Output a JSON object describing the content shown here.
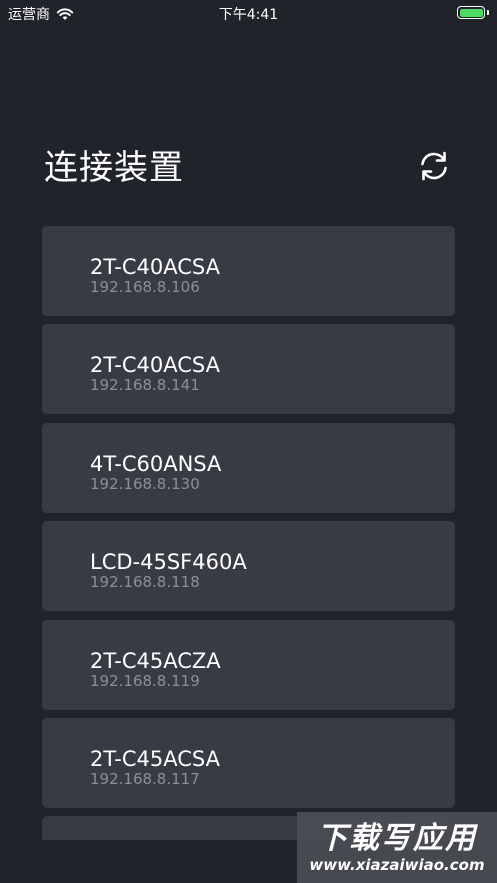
{
  "status_bar": {
    "carrier": "运营商",
    "wifi_icon": "wifi-icon",
    "time": "下午4:41",
    "battery_level": 1.0,
    "battery_color": "#4cd964"
  },
  "header": {
    "title": "连接装置",
    "refresh_icon": "refresh-icon"
  },
  "devices": [
    {
      "name": "2T-C40ACSA",
      "ip": "192.168.8.106"
    },
    {
      "name": "2T-C40ACSA",
      "ip": "192.168.8.141"
    },
    {
      "name": "4T-C60ANSA",
      "ip": "192.168.8.130"
    },
    {
      "name": "LCD-45SF460A",
      "ip": "192.168.8.118"
    },
    {
      "name": "2T-C45ACZA",
      "ip": "192.168.8.119"
    },
    {
      "name": "2T-C45ACSA",
      "ip": "192.168.8.117"
    },
    {
      "name": "",
      "ip": ""
    }
  ],
  "watermark": {
    "title": "下载写应用",
    "url": "www.xiazaiwiao.com"
  },
  "colors": {
    "background": "#202329",
    "card": "#383b44",
    "secondary_text": "#8c8f96"
  }
}
